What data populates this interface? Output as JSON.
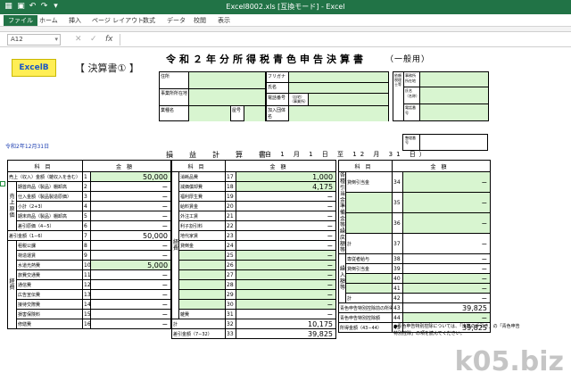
{
  "window": {
    "title": "Excel8002.xls [互換モード] - Excel",
    "quick_access": [
      "save-icon",
      "undo-icon",
      "redo-icon"
    ]
  },
  "ribbon": {
    "tabs": [
      "ファイル",
      "ホーム",
      "挿入",
      "ページ レイアウト",
      "数式",
      "データ",
      "校閲",
      "表示"
    ],
    "active_tab": "ファイル"
  },
  "formula_bar": {
    "name_box": "A12",
    "cancel": "✕",
    "enter": "✓",
    "fx": "fx",
    "value": ""
  },
  "sheet": {
    "logo_button": "ExcelB",
    "subtitle": "【 決算書① 】",
    "title": "令和２年分所得税青色申告決算書",
    "title_suffix": "（一般用）",
    "date_label": "令和2年12月31日",
    "pl_title": "損益計算書",
    "pl_period": "（自 1 月 1 日 至 12 月 31 日）",
    "seiri_label": "整理番号",
    "header_form": {
      "left_labels": [
        "住所",
        "事業所所在地",
        "業種名"
      ],
      "mid_labels": [
        "フリガナ",
        "氏名",
        "電話番号",
        "屋号",
        "加入団体名"
      ],
      "phone_marks": [
        "（自宅）",
        "（事業所）"
      ],
      "right_labels": [
        "依頼税理士等",
        "事務所所在地",
        "氏名（名称）",
        "電話番号"
      ]
    },
    "col_header_left": [
      "科目",
      "金額"
    ],
    "col_header_mid": [
      "科目",
      "金額"
    ],
    "col_header_right": [
      "科目",
      "金額"
    ],
    "left_rows": [
      {
        "no": "1",
        "label": "売上（収入）金額（雑収入を含む）",
        "value": "50,000",
        "green": true
      },
      {
        "no": "2",
        "label": "期首商品（製品）棚卸高",
        "value": "−",
        "green": false
      },
      {
        "no": "3",
        "label": "仕入金額（製品製造原価）",
        "value": "−",
        "green": false
      },
      {
        "no": "4",
        "label": "小計（2+3）",
        "value": "−",
        "green": false
      },
      {
        "no": "5",
        "label": "期末商品（製品）棚卸高",
        "value": "−",
        "green": false
      },
      {
        "no": "6",
        "label": "差引原価（4−5）",
        "value": "−",
        "green": false
      },
      {
        "no": "7",
        "label": "差引金額（1−6）",
        "value": "50,000",
        "green": false
      },
      {
        "no": "8",
        "label": "租税公課",
        "value": "−",
        "green": false
      },
      {
        "no": "9",
        "label": "荷造運賃",
        "value": "−",
        "green": false
      },
      {
        "no": "10",
        "label": "水道光熱費",
        "value": "5,000",
        "green": true
      },
      {
        "no": "11",
        "label": "旅費交通費",
        "value": "−",
        "green": false
      },
      {
        "no": "12",
        "label": "通信費",
        "value": "−",
        "green": false
      },
      {
        "no": "13",
        "label": "広告宣伝費",
        "value": "−",
        "green": false
      },
      {
        "no": "14",
        "label": "接待交際費",
        "value": "−",
        "green": false
      },
      {
        "no": "15",
        "label": "損害保険料",
        "value": "−",
        "green": false
      },
      {
        "no": "16",
        "label": "修繕費",
        "value": "−",
        "green": false
      }
    ],
    "left_groups": [
      "売上原価",
      "経費"
    ],
    "mid_rows": [
      {
        "no": "17",
        "label": "消耗品費",
        "value": "1,000",
        "green": true
      },
      {
        "no": "18",
        "label": "減価償却費",
        "value": "4,175",
        "green": true
      },
      {
        "no": "19",
        "label": "福利厚生費",
        "value": "−",
        "green": false
      },
      {
        "no": "20",
        "label": "給料賃金",
        "value": "−",
        "green": false
      },
      {
        "no": "21",
        "label": "外注工賃",
        "value": "−",
        "green": false
      },
      {
        "no": "22",
        "label": "利子割引料",
        "value": "−",
        "green": false
      },
      {
        "no": "23",
        "label": "地代家賃",
        "value": "−",
        "green": false
      },
      {
        "no": "24",
        "label": "貸倒金",
        "value": "−",
        "green": false
      },
      {
        "no": "25",
        "label": "",
        "value": "−",
        "green": true
      },
      {
        "no": "26",
        "label": "",
        "value": "−",
        "green": true
      },
      {
        "no": "27",
        "label": "",
        "value": "−",
        "green": true
      },
      {
        "no": "28",
        "label": "",
        "value": "−",
        "green": true
      },
      {
        "no": "29",
        "label": "",
        "value": "−",
        "green": true
      },
      {
        "no": "30",
        "label": "",
        "value": "−",
        "green": true
      },
      {
        "no": "31",
        "label": "雑費",
        "value": "−",
        "green": false
      },
      {
        "no": "32",
        "label": "計",
        "value": "10,175",
        "green": false
      },
      {
        "no": "33",
        "label": "差引金額（7−32）",
        "value": "39,825",
        "green": false
      }
    ],
    "mid_group": "経費",
    "right_rows": [
      {
        "no": "34",
        "label": "貸倒引当金",
        "value": "−",
        "green": true
      },
      {
        "no": "35",
        "label": "",
        "value": "−",
        "green": true
      },
      {
        "no": "36",
        "label": "",
        "value": "−",
        "green": true
      },
      {
        "no": "37",
        "label": "計",
        "value": "−",
        "green": false
      },
      {
        "no": "38",
        "label": "専従者給与",
        "value": "−",
        "green": false
      },
      {
        "no": "39",
        "label": "貸倒引当金",
        "value": "−",
        "green": false
      },
      {
        "no": "40",
        "label": "",
        "value": "−",
        "green": true
      },
      {
        "no": "41",
        "label": "",
        "value": "−",
        "green": true
      },
      {
        "no": "42",
        "label": "計",
        "value": "−",
        "green": false
      },
      {
        "no": "43",
        "label": "青色申告特別控除前の所得金額（33+37−42）",
        "value": "39,825",
        "green": false
      },
      {
        "no": "44",
        "label": "青色申告特別控除額",
        "value": "−",
        "green": true
      },
      {
        "no": "45",
        "label": "所得金額（43−44）",
        "value": "39,825",
        "green": false
      }
    ],
    "right_groups": [
      "各種引当金・準備金等 繰戻額等",
      "繰入額等"
    ],
    "note": [
      "●青色申告特別控除については、「決算の手引き」の「青色申告",
      "特別控除」の項を読んでください。"
    ],
    "watermark": "k05.biz"
  }
}
